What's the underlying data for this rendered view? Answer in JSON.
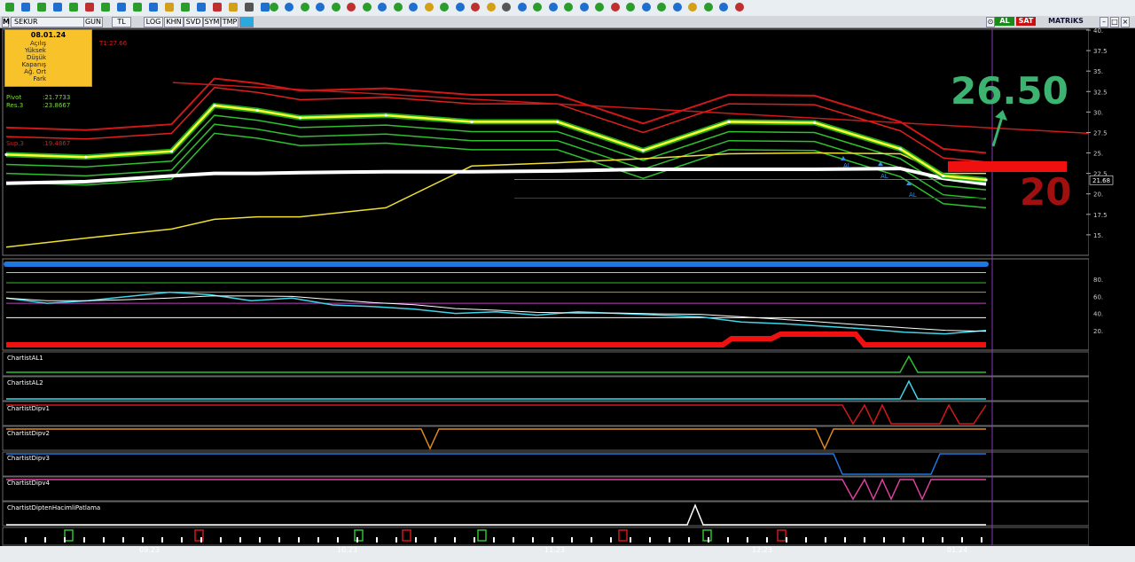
{
  "toolbar": {
    "icons": [
      "lock-icon",
      "cursor-icon",
      "crosshair-icon",
      "draw-line-icon",
      "trend-line-icon",
      "fib-icon",
      "text-icon",
      "shape-icon",
      "arrow-icon",
      "channel-icon",
      "gann-icon",
      "zoom-in-icon",
      "zoom-out-icon",
      "refresh-icon",
      "bell-icon",
      "print-icon",
      "settings-icon"
    ]
  },
  "tabs": {
    "symbol": "SEKUR",
    "items": [
      "GUN",
      "TL",
      "LOG",
      "KHN",
      "SVD",
      "SYM",
      "TMP"
    ],
    "al_label": "AL",
    "sat_label": "SAT",
    "brand": "MATRiKS"
  },
  "infobox": {
    "date": "08.01.24",
    "rows": [
      "Açılış",
      "Yüksek",
      "Düşük",
      "Kapanış",
      "Ağ. Ort",
      "Fark"
    ]
  },
  "price_labels": {
    "t1": "T1:27.66",
    "pivot_label": "Pivot",
    "pivot_value": ":21.7733",
    "res3_label": "Res.3",
    "res3_value": ":23.8667",
    "sup3_label": "Sup.3",
    "sup3_value": ":19.4867"
  },
  "annotations": {
    "target": "26.50",
    "support": "20",
    "signal": "AL"
  },
  "panels": {
    "names": [
      "ChartistAL1",
      "ChartistAL2",
      "ChartistDipv1",
      "ChartistDipv2",
      "ChartistDipv3",
      "ChartistDipv4",
      "ChartistDiptenHacimliPatlama"
    ]
  },
  "colors": {
    "accent_green": "#3cb371",
    "support_red": "#b01010",
    "price_line": "#ffff33",
    "toolbar_bg": "#e9eef2"
  },
  "chart_data": {
    "type": "line",
    "title": "",
    "xlabel": "",
    "ylabel": "",
    "ylim": [
      12.5,
      40
    ],
    "yticks": [
      "40.",
      "37.5",
      "35.",
      "32.5",
      "30.",
      "27.5",
      "25.",
      "22.5",
      "20.",
      "17.5",
      "15."
    ],
    "last_price": "21.68",
    "x_tick_labels": [
      "09.23",
      "10.23",
      "11.23",
      "12.23",
      "01.24"
    ],
    "x": [
      "2023-08-01",
      "2023-08-14",
      "2023-08-28",
      "2023-09-04",
      "2023-09-11",
      "2023-09-18",
      "2023-10-02",
      "2023-10-16",
      "2023-10-30",
      "2023-11-13",
      "2023-11-27",
      "2023-12-11",
      "2023-12-25",
      "2024-01-01",
      "2024-01-08"
    ],
    "series": [
      {
        "values": [
          24.8,
          24.5,
          25.2,
          30.8,
          30.2,
          29.3,
          29.6,
          28.8,
          28.8,
          25.3,
          28.8,
          28.7,
          25.5,
          22.2,
          21.7
        ]
      },
      {
        "values": [
          21.3,
          21.5,
          22.2,
          22.5,
          22.5,
          22.6,
          22.7,
          22.7,
          22.8,
          23.0,
          23.0,
          23.0,
          23.1,
          21.9,
          21.2
        ]
      },
      {
        "values": [
          13.5,
          14.6,
          15.7,
          16.9,
          17.2,
          17.2,
          18.3,
          23.4,
          23.8,
          24.3,
          24.9,
          25.0,
          24.9,
          22.5,
          22.5
        ]
      }
    ],
    "resistance_line": [
      [
        0.17,
        33.6
      ],
      [
        1.0,
        27.4
      ]
    ],
    "rsi_panel": {
      "ylim": [
        0,
        100
      ],
      "yticks": [
        "80.",
        "60.",
        "40.",
        "20."
      ]
    }
  }
}
